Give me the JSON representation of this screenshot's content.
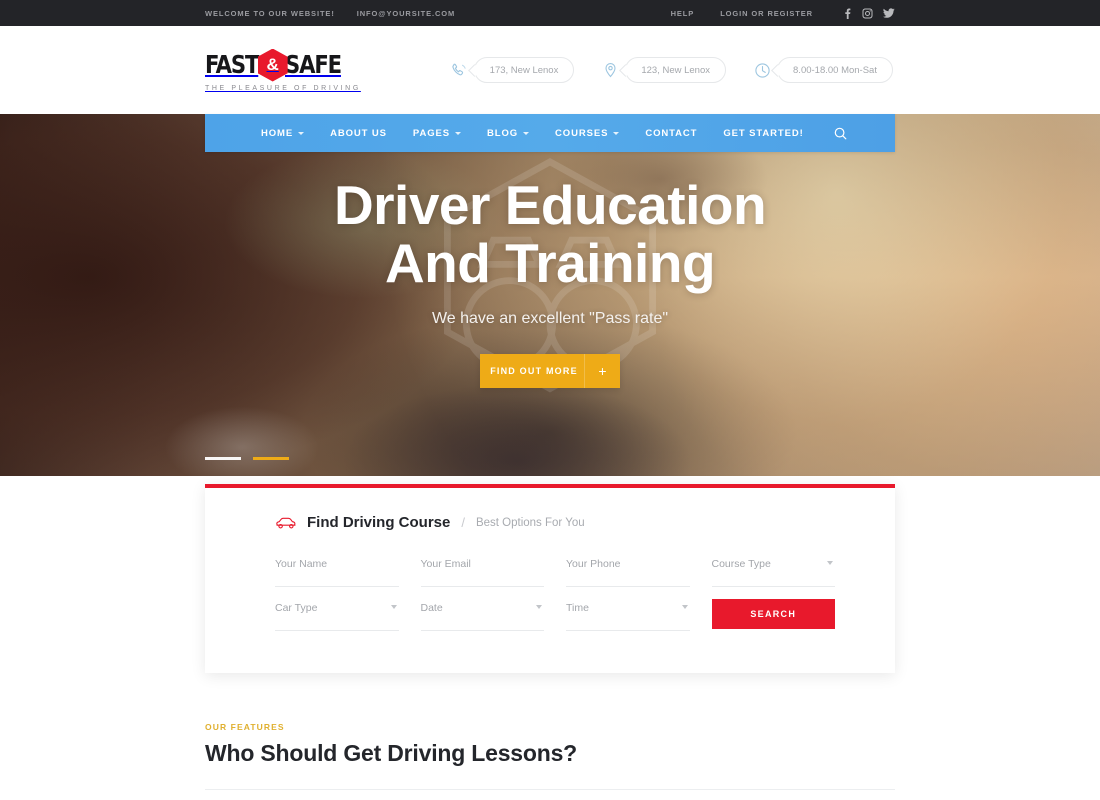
{
  "colors": {
    "topbar_bg": "#232428",
    "nav_blue": "#55aaea",
    "accent_red": "#e8192c",
    "accent_amber": "#eeab17",
    "eyebrow_gold": "#e0b02f",
    "dark_text": "#24262b",
    "muted_text": "#a3a6ab"
  },
  "topbar": {
    "welcome": "WELCOME TO OUR WEBSITE!",
    "email": "INFO@YOURSITE.COM",
    "help": "HELP",
    "login": "LOGIN OR REGISTER",
    "social": [
      {
        "name": "facebook-icon",
        "label": "Facebook"
      },
      {
        "name": "instagram-icon",
        "label": "Instagram"
      },
      {
        "name": "twitter-icon",
        "label": "Twitter"
      }
    ]
  },
  "logo": {
    "word1": "FAST",
    "ampersand": "&",
    "word2": "SAFE",
    "tagline": "THE PLEASURE OF DRIVING"
  },
  "contacts": [
    {
      "icon": "phone-icon",
      "text": "173, New Lenox"
    },
    {
      "icon": "map-pin-icon",
      "text": "123, New Lenox"
    },
    {
      "icon": "clock-icon",
      "text": "8.00-18.00 Mon-Sat"
    }
  ],
  "nav": {
    "items": [
      {
        "label": "HOME",
        "dropdown": true
      },
      {
        "label": "ABOUT US",
        "dropdown": false
      },
      {
        "label": "PAGES",
        "dropdown": true
      },
      {
        "label": "BLOG",
        "dropdown": true
      },
      {
        "label": "COURSES",
        "dropdown": true
      },
      {
        "label": "CONTACT",
        "dropdown": false
      },
      {
        "label": "GET STARTED!",
        "dropdown": false
      }
    ],
    "search_icon": "search-icon"
  },
  "hero": {
    "title_line1": "Driver Education",
    "title_line2": "And Training",
    "subtitle": "We have an excellent \"Pass rate\"",
    "cta_label": "FIND OUT MORE",
    "cta_plus": "+",
    "slides": [
      {
        "active": false
      },
      {
        "active": true
      }
    ]
  },
  "form": {
    "title": "Find Driving Course",
    "separator": "/",
    "subtitle": "Best Options For You",
    "icon": "car-icon",
    "row1": [
      {
        "placeholder": "Your Name",
        "type": "text",
        "name": "your-name-input"
      },
      {
        "placeholder": "Your Email",
        "type": "text",
        "name": "your-email-input"
      },
      {
        "placeholder": "Your Phone",
        "type": "text",
        "name": "your-phone-input"
      },
      {
        "placeholder": "Course Type",
        "type": "select",
        "name": "course-type-select"
      }
    ],
    "row2": [
      {
        "placeholder": "Car Type",
        "type": "select",
        "name": "car-type-select"
      },
      {
        "placeholder": "Date",
        "type": "select",
        "name": "date-select"
      },
      {
        "placeholder": "Time",
        "type": "select",
        "name": "time-select"
      }
    ],
    "search_label": "SEARCH"
  },
  "features": {
    "eyebrow": "OUR FEATURES",
    "title": "Who Should Get Driving Lessons?"
  }
}
